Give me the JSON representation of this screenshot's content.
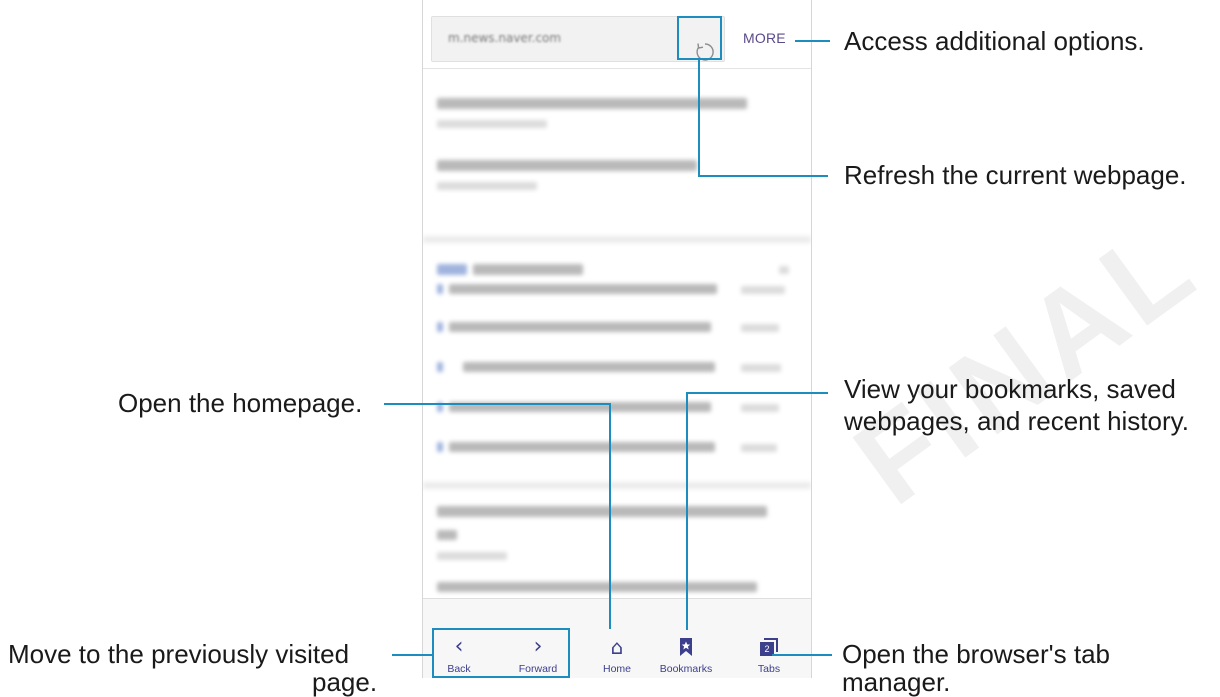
{
  "browser": {
    "url": "m.news.naver.com",
    "more_label": "MORE",
    "tab_count": "2",
    "bottom_nav": [
      {
        "label": "Back",
        "icon": "chevron-left-icon"
      },
      {
        "label": "Forward",
        "icon": "chevron-right-icon"
      },
      {
        "label": "Home",
        "icon": "home-icon"
      },
      {
        "label": "Bookmarks",
        "icon": "bookmark-icon"
      },
      {
        "label": "Tabs",
        "icon": "tabs-icon"
      }
    ],
    "accent_color": "#3c3f8c"
  },
  "callouts": {
    "more": "Access additional options.",
    "refresh": "Refresh the current webpage.",
    "bookmarks_line1": "View your bookmarks, saved",
    "bookmarks_line2": "webpages, and recent history.",
    "home": "Open the homepage.",
    "back_line1": "Move to the previously visited",
    "back_line2": "page.",
    "tabs_line1": "Open the browser's tab",
    "tabs_line2": "manager.",
    "line_color": "#1d8dc0"
  },
  "watermark": "FINAL"
}
